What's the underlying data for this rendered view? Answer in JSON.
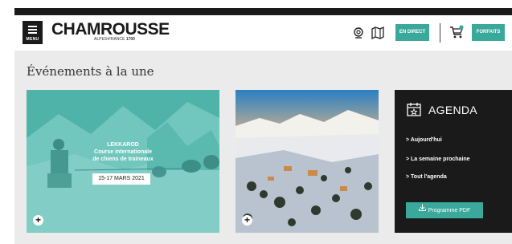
{
  "header": {
    "menu_label": "MENU",
    "logo_text": "CHAMROUSSE",
    "logo_sub_prefix": "ALPES•FRANCE ",
    "logo_sub_alt": "1700",
    "webcam_icon": "webcam-icon",
    "map_icon": "map-icon",
    "live_label": "EN DIRECT",
    "cart_icon": "cart-icon",
    "forfaits_label": "FORFAITS",
    "accent_color": "#3aa99b"
  },
  "main": {
    "section_title": "Événements à la une",
    "event_card": {
      "title": "LEKKAROD",
      "subtitle_line1": "Course internationale",
      "subtitle_line2": "de chiens de traineaux",
      "date": "15-17 MARS 2021",
      "plus_icon": "plus-icon",
      "overlay_color": "#3aa99b"
    },
    "photo_card": {
      "plus_icon": "plus-icon"
    },
    "agenda": {
      "icon": "calendar-star-icon",
      "title": "AGENDA",
      "links": [
        "> Aujourd'hui",
        "> La semaine prochaine",
        "> Tout l'agenda"
      ],
      "pdf_icon": "download-icon",
      "pdf_label": "Programme PDF"
    }
  }
}
